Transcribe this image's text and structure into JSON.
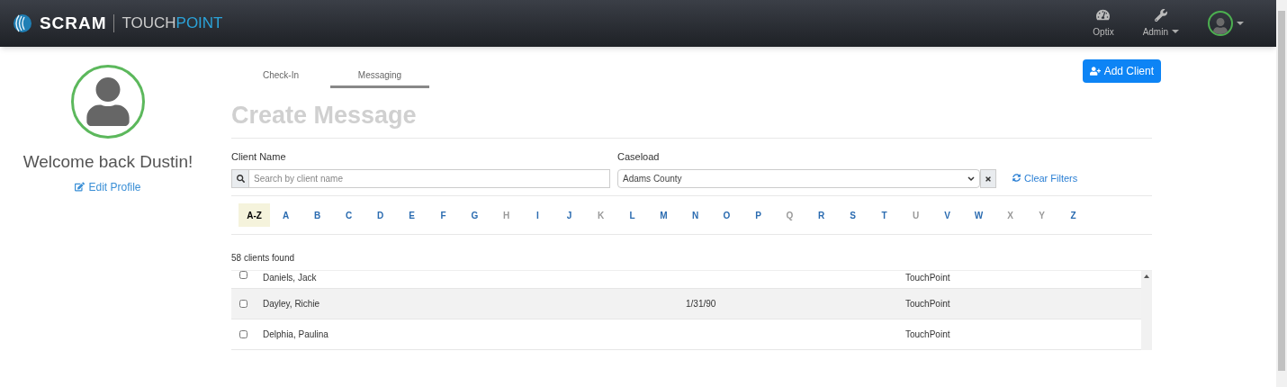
{
  "header": {
    "logo_primary": "SCRAM",
    "logo_secondary_a": "TOUCH",
    "logo_secondary_b": "POINT",
    "nav": [
      {
        "kind": "gauge",
        "label": "Optix",
        "dropdown": false
      },
      {
        "kind": "wrench",
        "label": "Admin",
        "dropdown": true
      }
    ],
    "user_menu": {
      "dropdown": true
    }
  },
  "profile": {
    "welcome": "Welcome back Dustin!",
    "edit_link": "Edit Profile"
  },
  "tabs": [
    {
      "label": "Check-In",
      "selected": false
    },
    {
      "label": "Messaging",
      "selected": true
    }
  ],
  "add_button": "Add Client",
  "title": "Create Message",
  "filters": {
    "client_label": "Client Name",
    "client_placeholder": "Search by client name",
    "caseload_label": "Caseload",
    "caseload_value": "Adams County",
    "clear": "Clear Filters"
  },
  "letters": [
    {
      "label": "A-Z",
      "selected": true,
      "disabled": false
    },
    {
      "label": "A",
      "selected": false,
      "disabled": false
    },
    {
      "label": "B",
      "selected": false,
      "disabled": false
    },
    {
      "label": "C",
      "selected": false,
      "disabled": false
    },
    {
      "label": "D",
      "selected": false,
      "disabled": false
    },
    {
      "label": "E",
      "selected": false,
      "disabled": false
    },
    {
      "label": "F",
      "selected": false,
      "disabled": false
    },
    {
      "label": "G",
      "selected": false,
      "disabled": false
    },
    {
      "label": "H",
      "selected": false,
      "disabled": true
    },
    {
      "label": "I",
      "selected": false,
      "disabled": false
    },
    {
      "label": "J",
      "selected": false,
      "disabled": false
    },
    {
      "label": "K",
      "selected": false,
      "disabled": true
    },
    {
      "label": "L",
      "selected": false,
      "disabled": false
    },
    {
      "label": "M",
      "selected": false,
      "disabled": false
    },
    {
      "label": "N",
      "selected": false,
      "disabled": false
    },
    {
      "label": "O",
      "selected": false,
      "disabled": false
    },
    {
      "label": "P",
      "selected": false,
      "disabled": false
    },
    {
      "label": "Q",
      "selected": false,
      "disabled": true
    },
    {
      "label": "R",
      "selected": false,
      "disabled": false
    },
    {
      "label": "S",
      "selected": false,
      "disabled": false
    },
    {
      "label": "T",
      "selected": false,
      "disabled": false
    },
    {
      "label": "U",
      "selected": false,
      "disabled": true
    },
    {
      "label": "V",
      "selected": false,
      "disabled": false
    },
    {
      "label": "W",
      "selected": false,
      "disabled": false
    },
    {
      "label": "X",
      "selected": false,
      "disabled": true
    },
    {
      "label": "Y",
      "selected": false,
      "disabled": true
    },
    {
      "label": "Z",
      "selected": false,
      "disabled": false
    }
  ],
  "count": "58 clients found",
  "rows": [
    {
      "name": "Daniels, Jack",
      "column_2": "",
      "column_3": "TouchPoint",
      "checked": false
    },
    {
      "name": "Dayley, Richie",
      "column_2": "1/31/90",
      "column_3": "TouchPoint",
      "checked": false
    },
    {
      "name": "Delphia, Paulina",
      "column_2": "",
      "column_3": "TouchPoint",
      "checked": false
    }
  ]
}
